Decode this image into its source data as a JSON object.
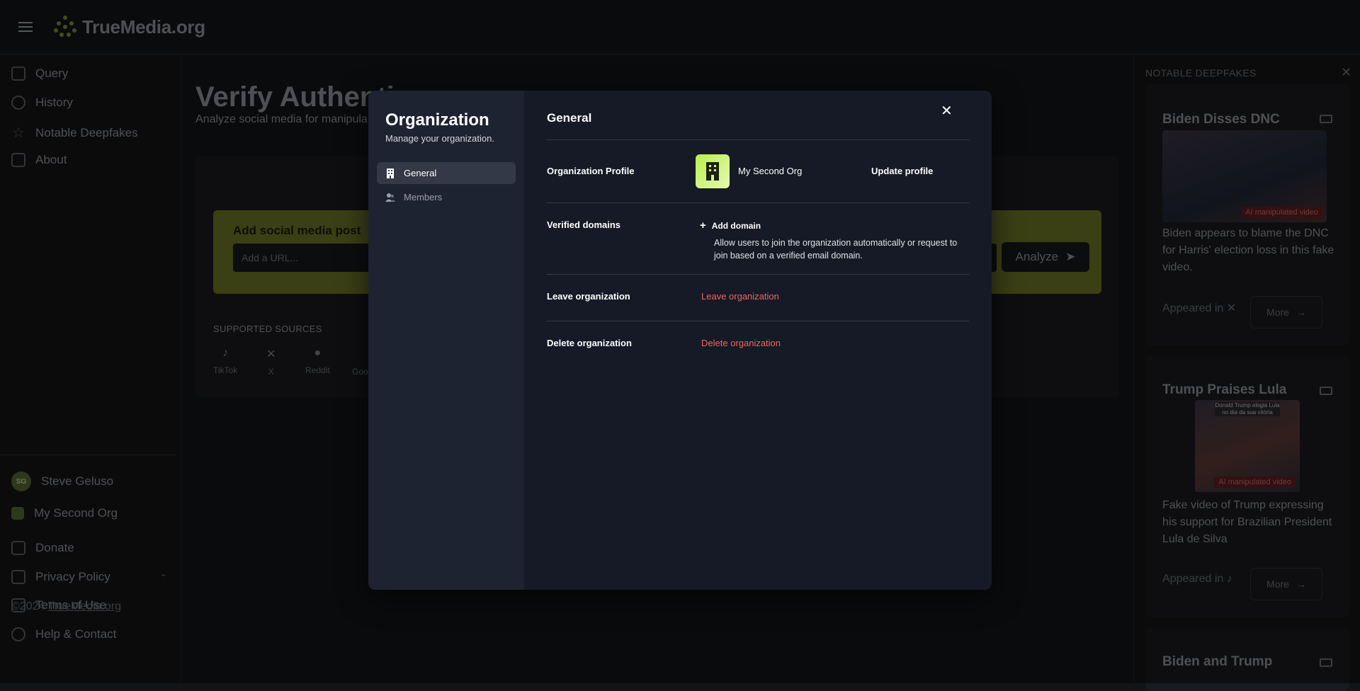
{
  "header": {
    "logo_text": "TrueMedia.org"
  },
  "sidebar": {
    "items": [
      {
        "label": "Query",
        "icon": "query-icon"
      },
      {
        "label": "History",
        "icon": "clock-icon"
      },
      {
        "label": "Notable Deepfakes",
        "icon": "star-icon"
      },
      {
        "label": "About",
        "icon": "external-link-icon"
      }
    ],
    "user": {
      "initials": "SG",
      "name": "Steve Geluso"
    },
    "org": {
      "name": "My Second Org"
    },
    "footer_items": [
      {
        "label": "Donate",
        "icon": "gift-icon"
      },
      {
        "label": "Privacy Policy",
        "icon": "clipboard-icon"
      },
      {
        "label": "Terms of Use",
        "icon": "stack-icon"
      },
      {
        "label": "Help & Contact",
        "icon": "lifebuoy-icon"
      }
    ],
    "copyright_prefix": "©2024 ",
    "copyright_link": "TrueMedia.org"
  },
  "main": {
    "title": "Verify Authenti",
    "subtitle": "Analyze social media for manipula",
    "post_label": "Add social media post",
    "url_placeholder": "Add a URL...",
    "analyze_label": "Analyze",
    "sources_label": "SUPPORTED SOURCES",
    "sources": [
      "TikTok",
      "X",
      "Reddit",
      "Goo"
    ]
  },
  "right_panel": {
    "title": "NOTABLE DEEPFAKES",
    "cards": [
      {
        "title": "Biden Disses DNC",
        "badge": "AI manipulated video",
        "description": "Biden appears to blame the DNC for Harris' election loss in this fake video.",
        "appeared": "Appeared in",
        "more": "More"
      },
      {
        "title": "Trump Praises Lula",
        "badge": "AI manipulated video",
        "caption": "Donald Trump elogia Lula no dia da sua vitória",
        "description": "Fake video of Trump expressing his support for Brazilian President Lula de Silva",
        "appeared": "Appeared in",
        "more": "More"
      },
      {
        "title": "Biden and Trump"
      }
    ]
  },
  "modal": {
    "title": "Organization",
    "subtitle": "Manage your organization.",
    "nav": [
      {
        "label": "General",
        "active": true
      },
      {
        "label": "Members",
        "active": false
      }
    ],
    "section_title": "General",
    "profile_label": "Organization Profile",
    "org_name": "My Second Org",
    "update_profile": "Update profile",
    "verified_domains_label": "Verified domains",
    "add_domain": "Add domain",
    "domain_help": "Allow users to join the organization automatically or request to join based on a verified email domain.",
    "leave_label": "Leave organization",
    "leave_action": "Leave organization",
    "delete_label": "Delete organization",
    "delete_action": "Delete organization"
  },
  "colors": {
    "danger": "#f06661",
    "accent": "#b7f04a"
  }
}
